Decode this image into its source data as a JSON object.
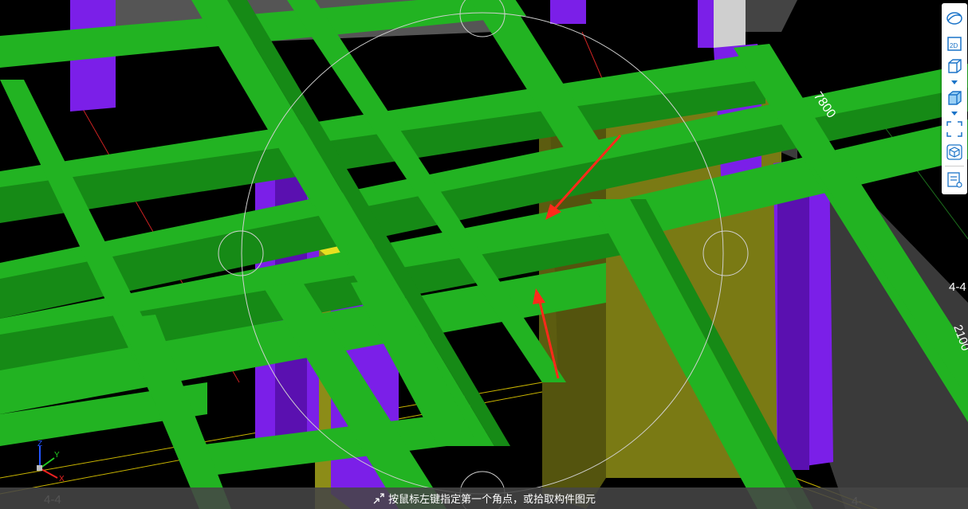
{
  "viewport": {
    "dimensions": {
      "d1": "7800",
      "d2": "4-4",
      "d3": "2100",
      "d4": "4-4",
      "d5": "4-"
    },
    "axis": {
      "x": "X",
      "y": "Y",
      "z": "Z"
    },
    "colors": {
      "beam": "#22b322",
      "beam_side": "#168a16",
      "column": "#7b1fe8",
      "column_side": "#5a10b0",
      "wall": "#7a7a14",
      "wall_dark": "#4e4e0a",
      "slab_gray": "#5a5a5a",
      "annotation_arrow": "#ff2a1a"
    }
  },
  "toolbar": {
    "items": [
      {
        "name": "orbit-icon"
      },
      {
        "name": "2d-view-icon",
        "label": "2D"
      },
      {
        "name": "cube-view-icon"
      },
      {
        "name": "caret-down-icon"
      },
      {
        "name": "shaded-cube-icon"
      },
      {
        "name": "caret-down-icon"
      },
      {
        "name": "zoom-extents-icon"
      },
      {
        "name": "3d-box-icon"
      },
      {
        "name": "properties-view-icon"
      }
    ]
  },
  "statusbar": {
    "prompt": "按鼠标左键指定第一个角点，或拾取构件图元"
  }
}
